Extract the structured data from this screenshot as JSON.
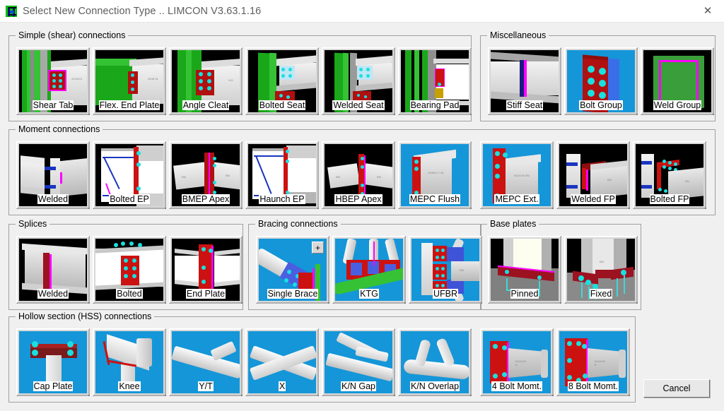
{
  "window": {
    "title": "Select New Connection Type  ..  LIMCON V3.63.1.16",
    "app_icon": "ibeam-icon",
    "close_label": "✕"
  },
  "groups": [
    {
      "key": "simple",
      "label": "Simple (shear) connections",
      "tiles": [
        {
          "label": "Shear Tab",
          "art": "shear-tab",
          "selected": false
        },
        {
          "label": "Flex. End Plate",
          "art": "flex-end-plate",
          "selected": false
        },
        {
          "label": "Angle Cleat",
          "art": "angle-cleat",
          "selected": false
        },
        {
          "label": "Bolted Seat",
          "art": "bolted-seat",
          "selected": false
        },
        {
          "label": "Welded Seat",
          "art": "welded-seat",
          "selected": false
        },
        {
          "label": "Bearing Pad",
          "art": "bearing-pad",
          "selected": false
        }
      ]
    },
    {
      "key": "misc",
      "label": "Miscellaneous",
      "tiles": [
        {
          "label": "Stiff Seat",
          "art": "stiff-seat",
          "selected": false
        },
        {
          "label": "Bolt Group",
          "art": "bolt-group",
          "selected": true
        },
        {
          "label": "Weld Group",
          "art": "weld-group",
          "selected": false
        }
      ]
    },
    {
      "key": "moment",
      "label": "Moment connections",
      "tiles": [
        {
          "label": "Welded",
          "art": "moment-welded",
          "selected": false
        },
        {
          "label": "Bolted EP",
          "art": "bolted-ep",
          "selected": false
        },
        {
          "label": "BMEP Apex",
          "art": "bmep-apex",
          "selected": false
        },
        {
          "label": "Haunch EP",
          "art": "haunch-ep",
          "selected": false
        },
        {
          "label": "HBEP Apex",
          "art": "hbep-apex",
          "selected": false
        },
        {
          "label": "MEPC Flush",
          "art": "mepc-flush",
          "selected": true
        },
        {
          "label": "MEPC Ext.",
          "art": "mepc-ext",
          "selected": true
        },
        {
          "label": "Welded FP",
          "art": "welded-fp",
          "selected": false
        },
        {
          "label": "Bolted FP",
          "art": "bolted-fp",
          "selected": false
        }
      ]
    },
    {
      "key": "splices",
      "label": "Splices",
      "tiles": [
        {
          "label": "Welded",
          "art": "splice-welded",
          "selected": false
        },
        {
          "label": "Bolted",
          "art": "splice-bolted",
          "selected": false
        },
        {
          "label": "End Plate",
          "art": "splice-endplate",
          "selected": false
        }
      ]
    },
    {
      "key": "bracing",
      "label": "Bracing connections",
      "tiles": [
        {
          "label": "Single Brace",
          "art": "single-brace",
          "selected": true,
          "badge": "+"
        },
        {
          "label": "KTG",
          "art": "ktg",
          "selected": true
        },
        {
          "label": "UFBR",
          "art": "ufbr",
          "selected": true
        }
      ]
    },
    {
      "key": "baseplates",
      "label": "Base plates",
      "tiles": [
        {
          "label": "Pinned",
          "art": "bp-pinned",
          "selected": false
        },
        {
          "label": "Fixed",
          "art": "bp-fixed",
          "selected": false
        }
      ]
    },
    {
      "key": "hss",
      "label": "Hollow section (HSS) connections",
      "tiles": [
        {
          "label": "Cap Plate",
          "art": "hss-cap-plate",
          "selected": true
        },
        {
          "label": "Knee",
          "art": "hss-knee",
          "selected": true
        },
        {
          "label": "Y/T",
          "art": "hss-yt",
          "selected": true
        },
        {
          "label": "X",
          "art": "hss-x",
          "selected": true
        },
        {
          "label": "K/N Gap",
          "art": "hss-kn-gap",
          "selected": true
        },
        {
          "label": "K/N Overlap",
          "art": "hss-kn-overlap",
          "selected": true
        },
        {
          "label": "4 Bolt Momt.",
          "art": "hss-4bolt",
          "selected": true
        },
        {
          "label": "8 Bolt Momt.",
          "art": "hss-8bolt",
          "selected": true
        }
      ]
    }
  ],
  "buttons": {
    "cancel": "Cancel"
  },
  "thumb_annotations": {
    "shear_tab": "410X8\n8",
    "flex_end_plate": "400B\n81",
    "angle_cleat": "410",
    "mepc_flush": "430B5J.7\n38",
    "mepc_ext": "M16X36\nBM"
  },
  "colors": {
    "window_bg": "#f0f0f0",
    "titlebar_bg": "#ffffff",
    "title_text": "#5e5e5e",
    "group_border": "#a0a0a0",
    "tile_face": "#d8d8d8",
    "thumb_blue": "#1596d8",
    "accent_red": "#b01010",
    "accent_green": "#1aa81a",
    "bolt_cyan": "#18e0e0",
    "magenta": "#ff00ff"
  }
}
